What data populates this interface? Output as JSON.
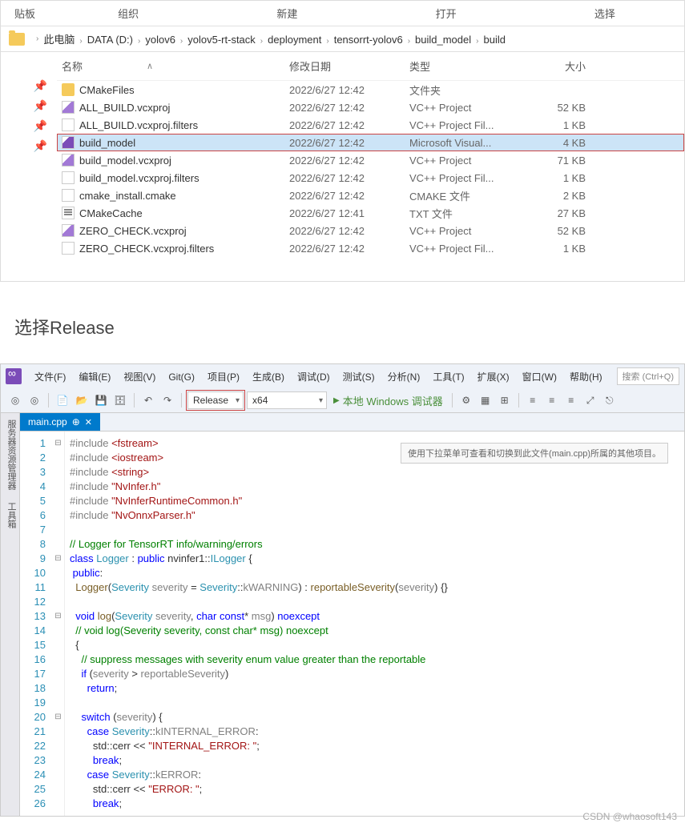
{
  "ribbon": {
    "paste": "贴板",
    "org": "组织",
    "new": "新建",
    "open": "打开",
    "select": "选择"
  },
  "breadcrumb": [
    "此电脑",
    "DATA (D:)",
    "yolov6",
    "yolov5-rt-stack",
    "deployment",
    "tensorrt-yolov6",
    "build_model",
    "build"
  ],
  "columns": {
    "name": "名称",
    "date": "修改日期",
    "type": "类型",
    "size": "大小"
  },
  "files": [
    {
      "name": "CMakeFiles",
      "date": "2022/6/27 12:42",
      "type": "文件夹",
      "size": "",
      "icon": "folder",
      "sel": false,
      "hl": false
    },
    {
      "name": "ALL_BUILD.vcxproj",
      "date": "2022/6/27 12:42",
      "type": "VC++ Project",
      "size": "52 KB",
      "icon": "vcxproj",
      "sel": false,
      "hl": false
    },
    {
      "name": "ALL_BUILD.vcxproj.filters",
      "date": "2022/6/27 12:42",
      "type": "VC++ Project Fil...",
      "size": "1 KB",
      "icon": "filters",
      "sel": false,
      "hl": false
    },
    {
      "name": "build_model",
      "date": "2022/6/27 12:42",
      "type": "Microsoft Visual...",
      "size": "4 KB",
      "icon": "sln",
      "sel": true,
      "hl": true
    },
    {
      "name": "build_model.vcxproj",
      "date": "2022/6/27 12:42",
      "type": "VC++ Project",
      "size": "71 KB",
      "icon": "vcxproj",
      "sel": false,
      "hl": false
    },
    {
      "name": "build_model.vcxproj.filters",
      "date": "2022/6/27 12:42",
      "type": "VC++ Project Fil...",
      "size": "1 KB",
      "icon": "filters",
      "sel": false,
      "hl": false
    },
    {
      "name": "cmake_install.cmake",
      "date": "2022/6/27 12:42",
      "type": "CMAKE 文件",
      "size": "2 KB",
      "icon": "cmake",
      "sel": false,
      "hl": false
    },
    {
      "name": "CMakeCache",
      "date": "2022/6/27 12:41",
      "type": "TXT 文件",
      "size": "27 KB",
      "icon": "txt",
      "sel": false,
      "hl": false
    },
    {
      "name": "ZERO_CHECK.vcxproj",
      "date": "2022/6/27 12:42",
      "type": "VC++ Project",
      "size": "52 KB",
      "icon": "vcxproj",
      "sel": false,
      "hl": false
    },
    {
      "name": "ZERO_CHECK.vcxproj.filters",
      "date": "2022/6/27 12:42",
      "type": "VC++ Project Fil...",
      "size": "1 KB",
      "icon": "filters",
      "sel": false,
      "hl": false
    }
  ],
  "heading": "选择Release",
  "vs": {
    "menu": [
      "文件(F)",
      "编辑(E)",
      "视图(V)",
      "Git(G)",
      "项目(P)",
      "生成(B)",
      "调试(D)",
      "测试(S)",
      "分析(N)",
      "工具(T)",
      "扩展(X)",
      "窗口(W)",
      "帮助(H)"
    ],
    "search": "搜索 (Ctrl+Q)",
    "config": "Release",
    "platform": "x64",
    "debugger": "本地 Windows 调试器",
    "tab": "main.cpp",
    "tooltip": "使用下拉菜单可查看和切换到此文件(main.cpp)所属的其他项目。",
    "sidebar": [
      "服务器资源管理器",
      "工具箱"
    ],
    "code": [
      {
        "n": 1,
        "fold": "⊟",
        "html": "<span class='var'>#include</span> <span class='ang'>&lt;fstream&gt;</span>"
      },
      {
        "n": 2,
        "fold": "",
        "html": "<span class='var'>#include</span> <span class='ang'>&lt;iostream&gt;</span>"
      },
      {
        "n": 3,
        "fold": "",
        "html": "<span class='var'>#include</span> <span class='ang'>&lt;string&gt;</span>"
      },
      {
        "n": 4,
        "fold": "",
        "html": "<span class='var'>#include</span> <span class='str'>\"NvInfer.h\"</span>"
      },
      {
        "n": 5,
        "fold": "",
        "html": "<span class='var'>#include</span> <span class='str'>\"NvInferRuntimeCommon.h\"</span>"
      },
      {
        "n": 6,
        "fold": "",
        "html": "<span class='var'>#include</span> <span class='str'>\"NvOnnxParser.h\"</span>"
      },
      {
        "n": 7,
        "fold": "",
        "html": ""
      },
      {
        "n": 8,
        "fold": "",
        "html": "<span class='cmt'>// Logger for TensorRT info/warning/errors</span>"
      },
      {
        "n": 9,
        "fold": "⊟",
        "html": "<span class='kw'>class</span> <span class='typ'>Logger</span> : <span class='kw'>public</span> nvinfer1::<span class='typ'>ILogger</span> {"
      },
      {
        "n": 10,
        "fold": "",
        "html": " <span class='kw'>public</span>:"
      },
      {
        "n": 11,
        "fold": "",
        "html": "  <span class='fn'>Logger</span>(<span class='typ'>Severity</span> <span class='var'>severity</span> = <span class='typ'>Severity</span>::<span class='var'>kWARNING</span>) : <span class='fn'>reportableSeverity</span>(<span class='var'>severity</span>) {}"
      },
      {
        "n": 12,
        "fold": "",
        "html": ""
      },
      {
        "n": 13,
        "fold": "⊟",
        "html": "  <span class='kw'>void</span> <span class='fn'>log</span>(<span class='typ'>Severity</span> <span class='var'>severity</span>, <span class='kw'>char</span> <span class='kw'>const</span>* <span class='var'>msg</span>) <span class='kw'>noexcept</span>"
      },
      {
        "n": 14,
        "fold": "",
        "html": "  <span class='cmt'>// void log(Severity severity, const char* msg) noexcept</span>"
      },
      {
        "n": 15,
        "fold": "",
        "html": "  {"
      },
      {
        "n": 16,
        "fold": "",
        "html": "    <span class='cmt'>// suppress messages with severity enum value greater than the reportable</span>"
      },
      {
        "n": 17,
        "fold": "",
        "html": "    <span class='kw'>if</span> (<span class='var'>severity</span> &gt; <span class='var'>reportableSeverity</span>)"
      },
      {
        "n": 18,
        "fold": "",
        "html": "      <span class='kw'>return</span>;"
      },
      {
        "n": 19,
        "fold": "",
        "html": ""
      },
      {
        "n": 20,
        "fold": "⊟",
        "html": "    <span class='kw'>switch</span> (<span class='var'>severity</span>) {"
      },
      {
        "n": 21,
        "fold": "",
        "html": "      <span class='kw'>case</span> <span class='typ'>Severity</span>::<span class='var'>kINTERNAL_ERROR</span>:"
      },
      {
        "n": 22,
        "fold": "",
        "html": "        std::cerr &lt;&lt; <span class='str'>\"INTERNAL_ERROR: \"</span>;"
      },
      {
        "n": 23,
        "fold": "",
        "html": "        <span class='kw'>break</span>;"
      },
      {
        "n": 24,
        "fold": "",
        "html": "      <span class='kw'>case</span> <span class='typ'>Severity</span>::<span class='var'>kERROR</span>:"
      },
      {
        "n": 25,
        "fold": "",
        "html": "        std::cerr &lt;&lt; <span class='str'>\"ERROR: \"</span>;"
      },
      {
        "n": 26,
        "fold": "",
        "html": "        <span class='kw'>break</span>;"
      }
    ]
  },
  "watermark": "CSDN @whaosoft143"
}
